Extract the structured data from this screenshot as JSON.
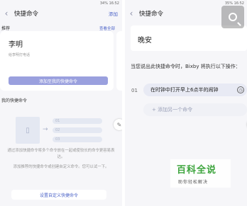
{
  "left": {
    "status_text": "34% 16:52",
    "title": "快捷命令",
    "header_action": "添加",
    "recommend_label": "推荐",
    "see_all": "查看全部",
    "card": {
      "name": "李明",
      "subtitle": "给李明打电话",
      "button": "添加至我的快捷命令"
    },
    "my_label": "我的快捷命令",
    "slots": [
      "01",
      "02",
      "03"
    ],
    "desc1": "通过添加快捷命令将多个命令放在一起或使较长的命令更容易表达。",
    "desc2": "添加推荐的快捷命令或创建自定义命令。您可以试一下。",
    "bottom_button": "设置自定义快捷命令"
  },
  "right": {
    "status_text": "35% 16:52",
    "title": "快捷命令",
    "command": "晚安",
    "prompt": "当您说出此快捷命令时，Bixby 将执行以下操作：",
    "items": [
      {
        "num": "01",
        "text": "在时钟中打开早上6点半的闹钟"
      }
    ],
    "add_label": "+ 添加另一个命令"
  },
  "watermark": {
    "title": "百科全说",
    "subtitle": "助你轻松解决"
  }
}
